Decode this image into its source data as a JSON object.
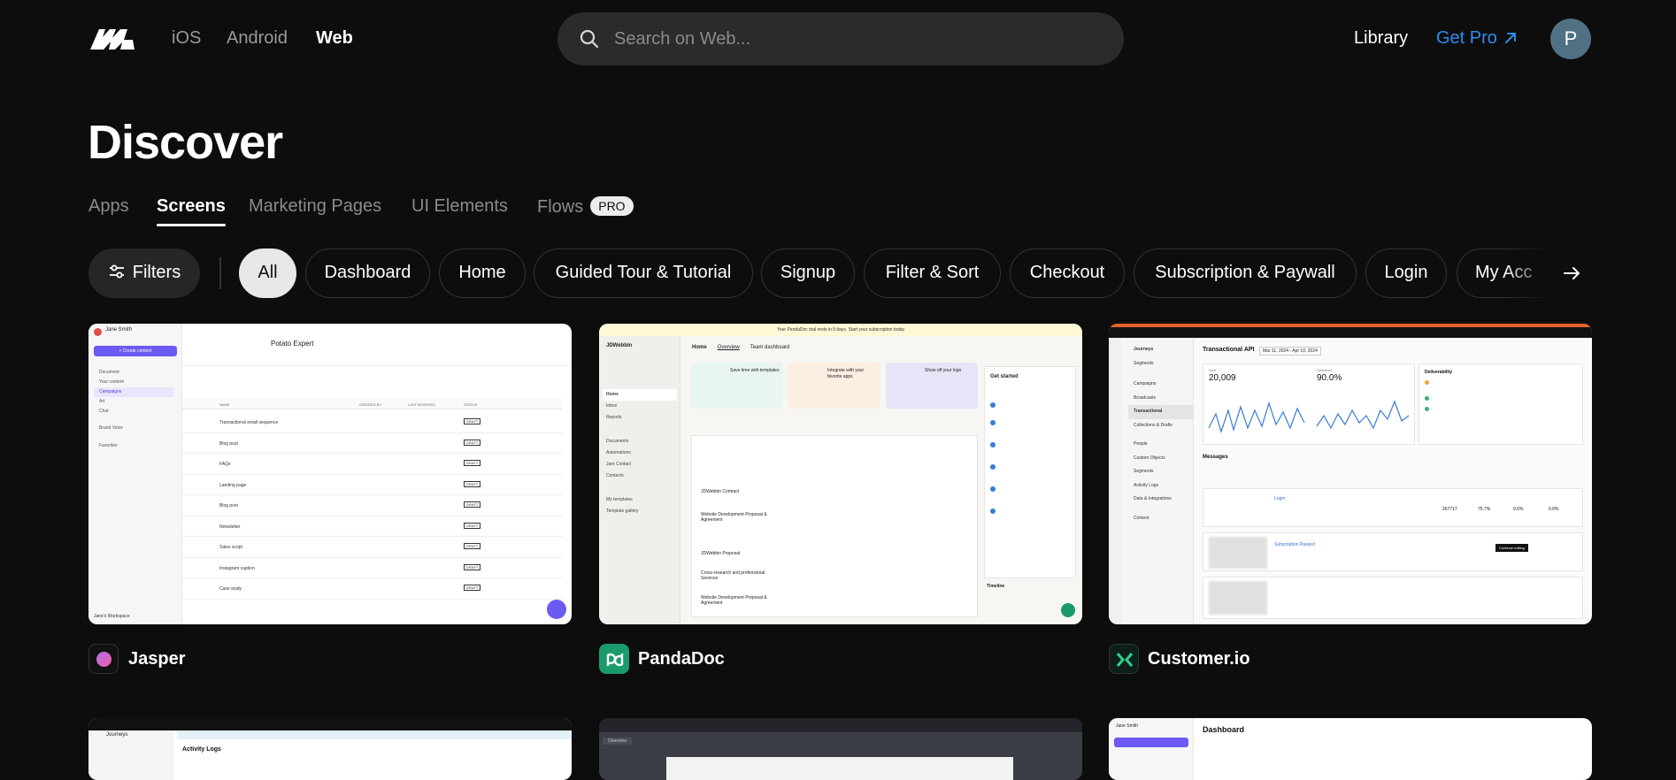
{
  "nav": {
    "platforms": [
      "iOS",
      "Android",
      "Web"
    ],
    "active_platform": "Web",
    "search_placeholder": "Search on Web...",
    "library": "Library",
    "get_pro": "Get Pro",
    "avatar_letter": "P"
  },
  "page": {
    "title": "Discover",
    "tabs": [
      "Apps",
      "Screens",
      "Marketing Pages",
      "UI Elements",
      "Flows"
    ],
    "active_tab": "Screens",
    "pro_badge": "PRO"
  },
  "filters": {
    "filters_label": "Filters",
    "chips": [
      "All",
      "Dashboard",
      "Home",
      "Guided Tour & Tutorial",
      "Signup",
      "Filter & Sort",
      "Checkout",
      "Subscription & Paywall",
      "Login",
      "My Acc"
    ],
    "selected": "All"
  },
  "cards": [
    {
      "app": "Jasper",
      "icon_color": "#b46cf2",
      "screen": {
        "user": "Jane Smith",
        "create": "+ Create content",
        "breadcrumb": "Potato Expert",
        "nav_items": [
          "Document",
          "Your content",
          "Campaigns",
          "Art",
          "Chat",
          "Brand Voice",
          "Favorites"
        ],
        "cols": [
          "NAME",
          "CREATED BY",
          "LAST MODIFIED",
          "STATUS"
        ],
        "rows": [
          "Transactional email sequence",
          "Blog post",
          "FAQs",
          "Landing page",
          "Blog post",
          "Newsletter",
          "Sales script",
          "Instagram caption",
          "Case study"
        ],
        "footer": "Jane's Workspace"
      }
    },
    {
      "app": "PandaDoc",
      "icon_color": "#1a9b6c",
      "screen": {
        "banner": "Your PandaDoc trial ends in 9 days. Start your subscription today",
        "brand": "JDWebbin",
        "nav": [
          "Home",
          "Inbox",
          "Reports",
          "Documents",
          "Automations",
          "Jam Contact",
          "Contacts",
          "My templates",
          "Template gallery"
        ],
        "tabs": [
          "Home",
          "Overview",
          "Team dashboard"
        ],
        "cards": [
          "Save time with templates",
          "Integrate with your favorite apps",
          "Show off your logo"
        ],
        "panel_title": "Get started",
        "doc_rows": [
          "JDWebbin Contract",
          "Website Development Proposal & Agreement",
          "JDWebbin Proposal",
          "Cross-research and professional Services",
          "Website Development Proposal & Agreement"
        ],
        "timeline": "Timeline"
      }
    },
    {
      "app": "Customer.io",
      "icon_color": "#11a873",
      "screen": {
        "title": "Transactional API",
        "date": "Mar 11, 2024 - Apr 10, 2024",
        "stat1_label": "Sent",
        "stat1": "20,009",
        "stat2_label": "Delivered",
        "stat2": "90.0%",
        "deliverability": "Deliverability",
        "messages": "Messages",
        "nav": [
          "Journeys",
          "Segments",
          "Campaigns",
          "Broadcasts",
          "Transactional",
          "Collections & Drafts",
          "People",
          "Custom Objects",
          "Segments",
          "Activity Logs",
          "Data & Integrations",
          "Content"
        ],
        "msg1": "Login",
        "msg1_stats": [
          "267717",
          "75.7%",
          "0.6%",
          "0.0%"
        ],
        "msg2": "Subscription Paused",
        "continue": "Continue editing"
      }
    }
  ],
  "bottom_cards": [
    {
      "label": "Journeys",
      "note": "Activity Logs"
    },
    {
      "label": "Overview"
    },
    {
      "label": "Dashboard",
      "user": "Jane Smith"
    }
  ]
}
